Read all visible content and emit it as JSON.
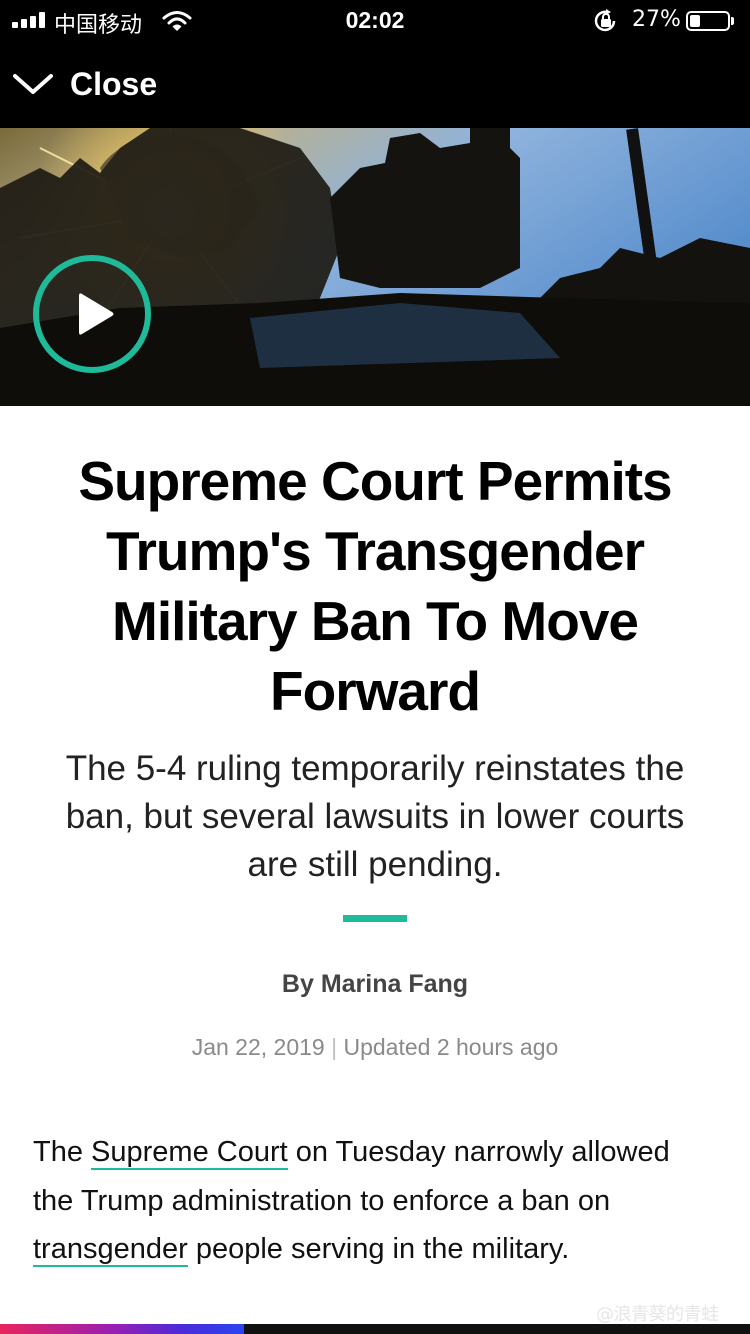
{
  "status_bar": {
    "carrier": "中国移动",
    "time": "02:02",
    "battery_percent": "27%",
    "battery_level": 0.27,
    "icons": [
      "signal-icon",
      "wifi-icon",
      "rotation-lock-icon",
      "battery-icon"
    ]
  },
  "nav": {
    "close_label": "Close",
    "icon": "chevron-down-icon"
  },
  "hero": {
    "play_icon": "play-icon",
    "accent_color": "#1fba99"
  },
  "article": {
    "headline": "Supreme Court Permits Trump's Transgender Military Ban To Move Forward",
    "subheadline": "The 5-4 ruling temporarily reinstates the ban, but several lawsuits in lower courts are still pending.",
    "byline": "By Marina Fang",
    "date": "Jan 22, 2019",
    "date_separator": "|",
    "updated": "Updated 2 hours ago",
    "body": {
      "part1": "The ",
      "link1": "Supreme Court",
      "part2": " on Tuesday narrowly allowed the Trump administration to enforce a ban on ",
      "link2": "transgender",
      "part3": " people serving in the military."
    }
  },
  "reading_progress": {
    "fraction": 0.325,
    "colors": [
      "#e8245c",
      "#9b1fb0",
      "#2a44f0"
    ]
  },
  "watermark": "@浪青葵的青蛙"
}
